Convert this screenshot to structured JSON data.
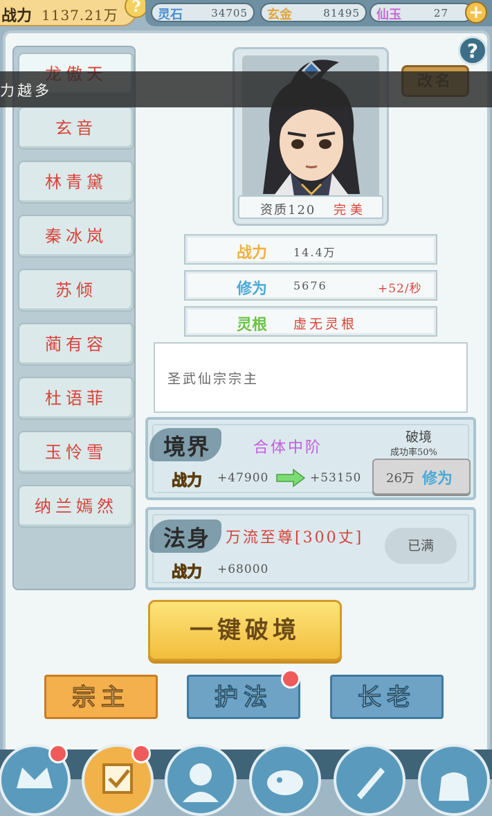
{
  "topbar": {
    "power_label": "战力",
    "power_value": "1137.21万",
    "power_info_glyph": "?",
    "currencies": [
      {
        "label": "灵石",
        "value": "34705",
        "color": "#4b8ed0"
      },
      {
        "label": "玄金",
        "value": "81495",
        "color": "#e1a53a"
      },
      {
        "label": "仙玉",
        "value": "27",
        "color": "#c46bd6"
      }
    ],
    "add_glyph": "+"
  },
  "help_glyph": "?",
  "characters": [
    {
      "name": "龙傲天",
      "selected": true
    },
    {
      "name": "玄音",
      "selected": false
    },
    {
      "name": "林青黛",
      "selected": false
    },
    {
      "name": "秦冰岚",
      "selected": false
    },
    {
      "name": "苏倾",
      "selected": false
    },
    {
      "name": "蔺有容",
      "selected": false
    },
    {
      "name": "杜语菲",
      "selected": false
    },
    {
      "name": "玉怜雪",
      "selected": false
    },
    {
      "name": "纳兰嫣然",
      "selected": false
    }
  ],
  "portrait": {
    "aptitude_label": "资质120",
    "aptitude_grade": "完美"
  },
  "rename_label": "改名",
  "toast_text": "力越多",
  "stats": [
    {
      "key": "战力",
      "value": "14.4万",
      "extra": "",
      "color": "#f0b03a"
    },
    {
      "key": "修为",
      "value": "5676",
      "extra": "+52/秒",
      "color": "#4aa9d6"
    },
    {
      "key": "灵根",
      "value": "虚无灵根",
      "extra": "",
      "color": "#6cc247"
    }
  ],
  "description": "圣武仙宗宗主",
  "realm": {
    "title": "境界",
    "level": "合体中阶",
    "break_label": "破境",
    "success_rate": "成功率50%",
    "power_label": "战力",
    "power_from": "+47900",
    "power_to": "+53150",
    "cost_amount": "26万",
    "cost_unit": "修为"
  },
  "dharma": {
    "title": "法身",
    "name": "万流至尊[300丈]",
    "power_label": "战力",
    "power_value": "+68000",
    "status": "已满"
  },
  "one_key_label": "一键破境",
  "tabs": [
    {
      "label": "宗主",
      "active": true,
      "dot": false
    },
    {
      "label": "护法",
      "active": false,
      "dot": true
    },
    {
      "label": "长老",
      "active": false,
      "dot": false
    }
  ]
}
